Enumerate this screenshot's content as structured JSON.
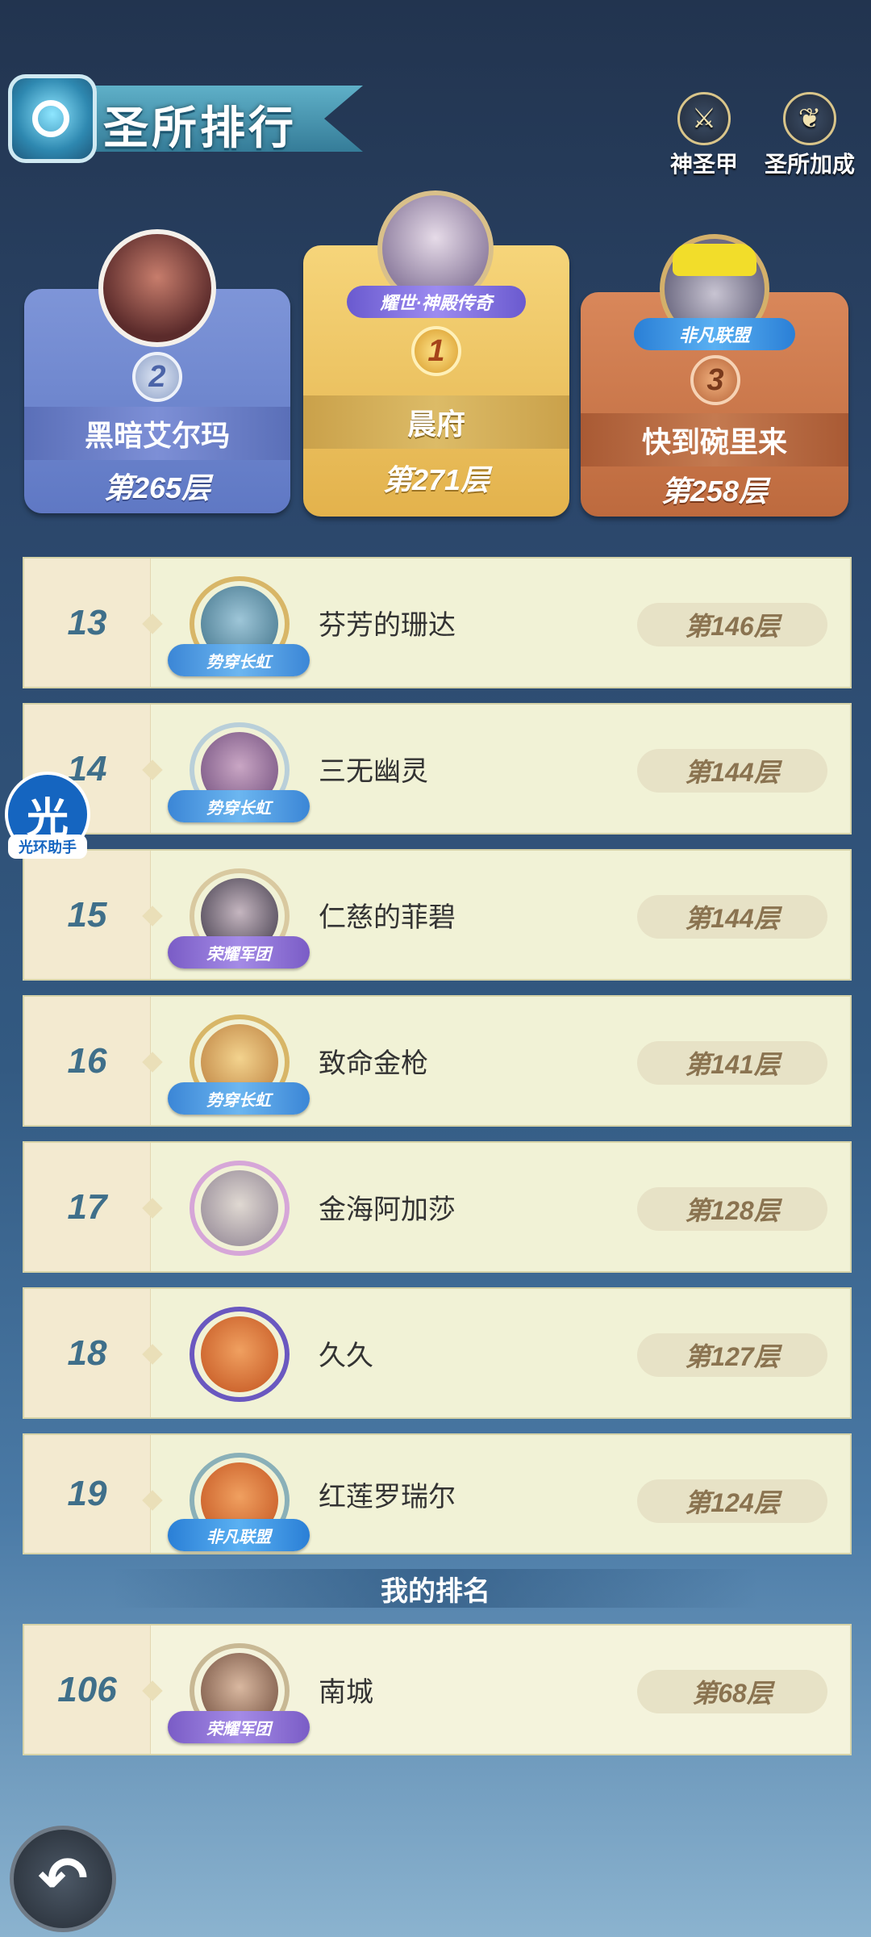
{
  "header": {
    "title": "圣所排行",
    "buttons": [
      {
        "label": "神圣甲",
        "icon": "holy-armor-icon"
      },
      {
        "label": "圣所加成",
        "icon": "sanctuary-bonus-icon"
      }
    ]
  },
  "podium": [
    {
      "rank": "1",
      "name": "晨府",
      "floor": "第271层",
      "badge": "耀世·神殿传奇"
    },
    {
      "rank": "2",
      "name": "黑暗艾尔玛",
      "floor": "第265层"
    },
    {
      "rank": "3",
      "name": "快到碗里来",
      "floor": "第258层",
      "badge": "非凡联盟"
    }
  ],
  "rows": [
    {
      "rank": "13",
      "name": "芬芳的珊达",
      "floor": "第146层",
      "tag": "势穿长虹"
    },
    {
      "rank": "14",
      "name": "三无幽灵",
      "floor": "第144层",
      "tag": "势穿长虹"
    },
    {
      "rank": "15",
      "name": "仁慈的菲碧",
      "floor": "第144层",
      "tag": "荣耀军团"
    },
    {
      "rank": "16",
      "name": "致命金枪",
      "floor": "第141层",
      "tag": "势穿长虹"
    },
    {
      "rank": "17",
      "name": "金海阿加莎",
      "floor": "第128层",
      "tag": ""
    },
    {
      "rank": "18",
      "name": "久久",
      "floor": "第127层",
      "tag": ""
    },
    {
      "rank": "19",
      "name": "红莲罗瑞尔",
      "floor": "第124层",
      "tag": "非凡联盟"
    }
  ],
  "my_rank_label": "我的排名",
  "my_rank": {
    "rank": "106",
    "name": "南城",
    "floor": "第68层",
    "tag": "荣耀军团"
  },
  "helper": {
    "char": "光",
    "label": "光环助手"
  },
  "colors": {
    "gold": "#f0c55a",
    "blue_card": "#7f98dc",
    "copper_card": "#c9784a",
    "row_bg": "#f1f2d6"
  }
}
